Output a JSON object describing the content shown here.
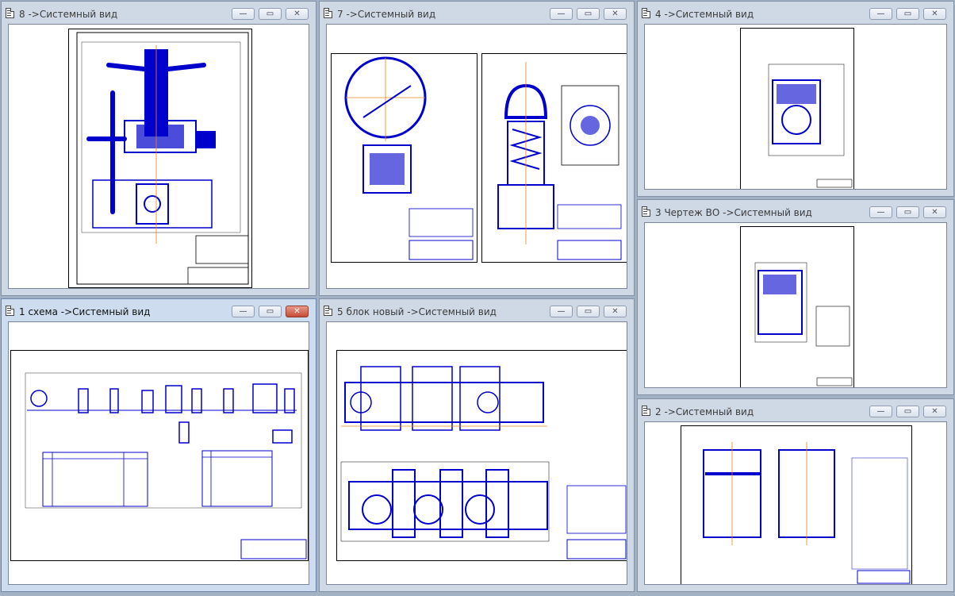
{
  "windows": [
    {
      "id": "w8",
      "title": "8 ->Системный вид",
      "active": false
    },
    {
      "id": "w7",
      "title": "7 ->Системный вид",
      "active": false
    },
    {
      "id": "w4",
      "title": "4 ->Системный вид",
      "active": false
    },
    {
      "id": "w3",
      "title": "3 Чертеж ВО ->Системный вид",
      "active": false
    },
    {
      "id": "w1",
      "title": "1 схема ->Системный вид",
      "active": true
    },
    {
      "id": "w5",
      "title": "5 блок новый ->Системный вид",
      "active": false
    },
    {
      "id": "w2",
      "title": "2 ->Системный вид",
      "active": false
    }
  ],
  "buttons": {
    "minimize": "—",
    "maximize": "▭",
    "close": "✕"
  },
  "colors": {
    "drawing_line": "#0000cc",
    "center_line": "#e08a1c",
    "desktop": "#a3b1c5"
  }
}
